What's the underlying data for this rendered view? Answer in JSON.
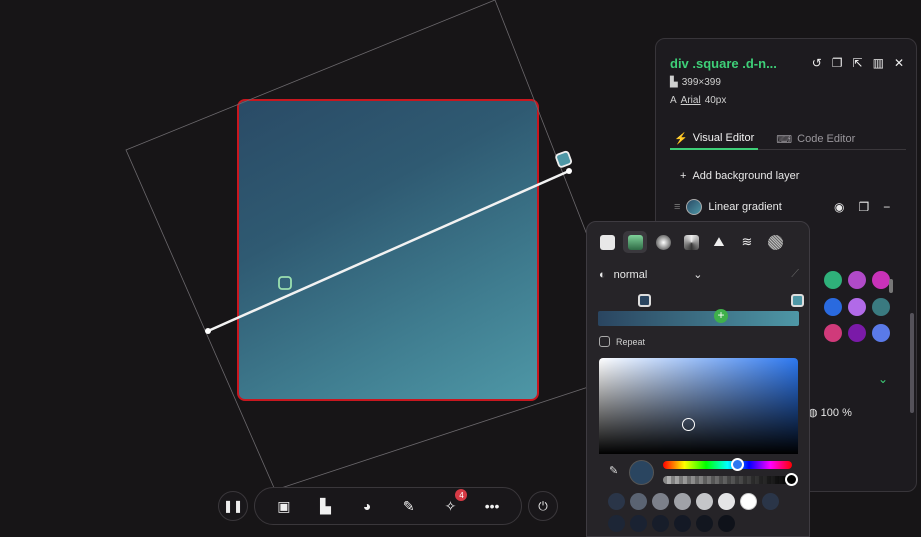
{
  "selection": {
    "title": "div .square .d-n...",
    "size": "399×399",
    "font_family": "Arial",
    "font_size": "40px"
  },
  "panel": {
    "tabs": [
      {
        "label": "Visual Editor"
      },
      {
        "label": "Code Editor"
      }
    ],
    "add_layer_label": "Add background layer",
    "layer": {
      "label": "Linear gradient"
    },
    "opacity": "100 %"
  },
  "picker": {
    "blend_mode": "normal",
    "repeat_label": "Repeat",
    "current_color": "#2a4560",
    "swatches": [
      "#2a3548",
      "#5a6372",
      "#7c808a",
      "#a0a2a8",
      "#c5c6c9",
      "#e4e4e6",
      "#ffffff",
      "#2a3548",
      "#1d2636",
      "#1a2232",
      "#171d2a",
      "#141925",
      "#12161f",
      "#0f121a"
    ]
  },
  "toolbar": {
    "notification_count": "4"
  },
  "gradient_colors": {
    "start": "#2a4b66",
    "end": "#4e97a6"
  },
  "accent": "#3ecf78",
  "selection_border": "#c8171f"
}
